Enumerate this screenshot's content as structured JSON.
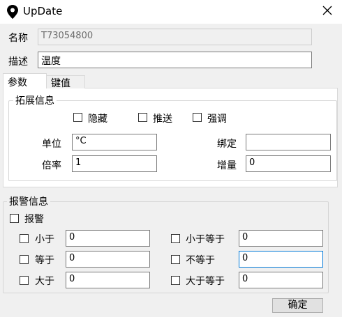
{
  "window": {
    "title": "UpDate",
    "icon": "location-pin-icon",
    "close_icon": "close-icon"
  },
  "form": {
    "name_label": "名称",
    "name_value": "T73054800",
    "desc_label": "描述",
    "desc_value": "温度"
  },
  "tabs": [
    {
      "label": "参数",
      "active": true
    },
    {
      "label": "键值",
      "active": false
    }
  ],
  "extended": {
    "legend": "拓展信息",
    "checkboxes": [
      {
        "label": "隐藏",
        "checked": false
      },
      {
        "label": "推送",
        "checked": false
      },
      {
        "label": "强调",
        "checked": false
      }
    ],
    "unit_label": "单位",
    "unit_value": "°C",
    "binding_label": "绑定",
    "binding_value": "",
    "ratio_label": "倍率",
    "ratio_value": "1",
    "increment_label": "增量",
    "increment_value": "0"
  },
  "alarm": {
    "legend": "报警信息",
    "enable_label": "报警",
    "enable_checked": false,
    "rows": [
      {
        "label": "小于",
        "value": "0"
      },
      {
        "label": "小于等于",
        "value": "0"
      },
      {
        "label": "等于",
        "value": "0"
      },
      {
        "label": "不等于",
        "value": "0"
      },
      {
        "label": "大于",
        "value": "0"
      },
      {
        "label": "大于等于",
        "value": "0"
      }
    ]
  },
  "footer": {
    "ok_label": "确定"
  }
}
